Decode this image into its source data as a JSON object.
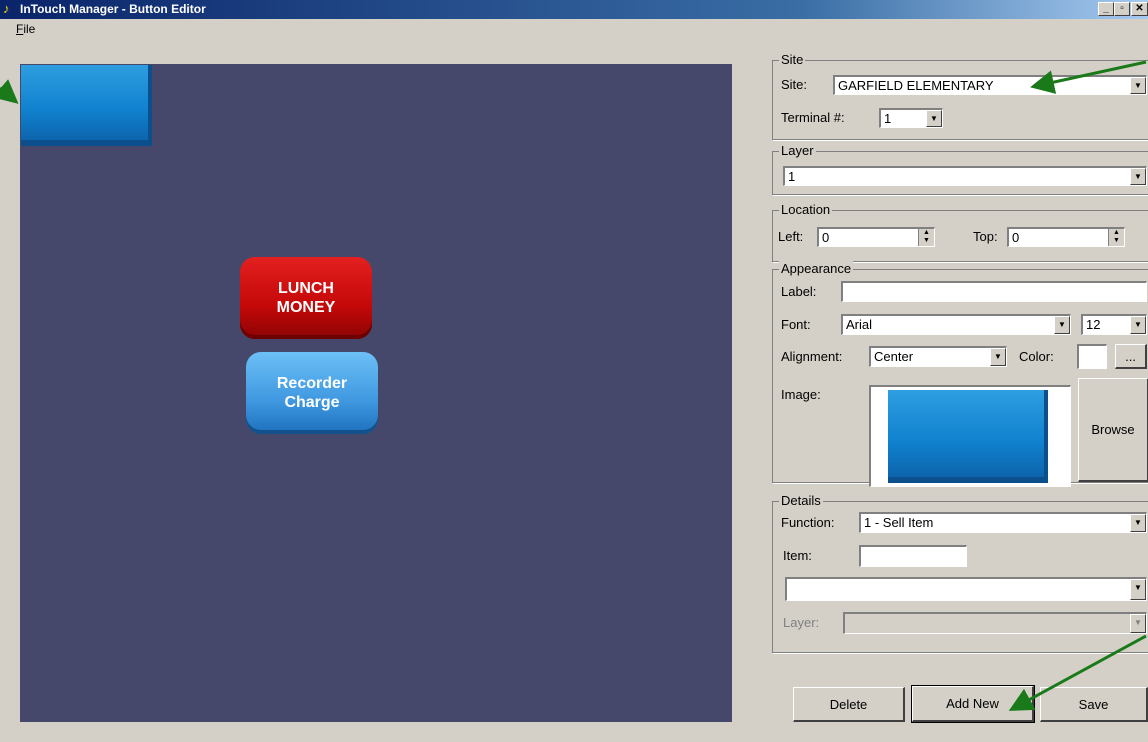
{
  "window": {
    "title": "InTouch Manager - Button Editor",
    "minimize": "_",
    "maximize": "▫",
    "close": "✕"
  },
  "menu": {
    "file_underlined": "F",
    "file_rest": "ile"
  },
  "canvas": {
    "background": "#45476b",
    "buttons": [
      {
        "label": "",
        "color": "#1082cf",
        "selected": true
      },
      {
        "label": "LUNCH\nMONEY",
        "color": "#c40808"
      },
      {
        "label": "Recorder\nCharge",
        "color": "#3f98e0"
      }
    ]
  },
  "site_group": {
    "legend": "Site",
    "site_label": "Site:",
    "site_value": "GARFIELD ELEMENTARY",
    "terminal_label": "Terminal #:",
    "terminal_value": "1"
  },
  "layer_group": {
    "legend": "Layer",
    "layer_value": "1"
  },
  "location_group": {
    "legend": "Location",
    "left_label": "Left:",
    "left_value": "0",
    "top_label": "Top:",
    "top_value": "0"
  },
  "appearance_group": {
    "legend": "Appearance",
    "label_label": "Label:",
    "label_value": "",
    "font_label": "Font:",
    "font_value": "Arial",
    "size_value": "12",
    "alignment_label": "Alignment:",
    "alignment_value": "Center",
    "color_label": "Color:",
    "color_value": "#ffffff",
    "color_button": "...",
    "image_label": "Image:",
    "browse_button": "Browse"
  },
  "details_group": {
    "legend": "Details",
    "function_label": "Function:",
    "function_value": "1 - Sell Item",
    "item_label": "Item:",
    "item_value": "",
    "item_select_value": "",
    "layer_label": "Layer:",
    "layer_value": ""
  },
  "actions": {
    "delete": "Delete",
    "add_new": "Add New",
    "save": "Save"
  },
  "annotation_color": "#1a7a1a"
}
